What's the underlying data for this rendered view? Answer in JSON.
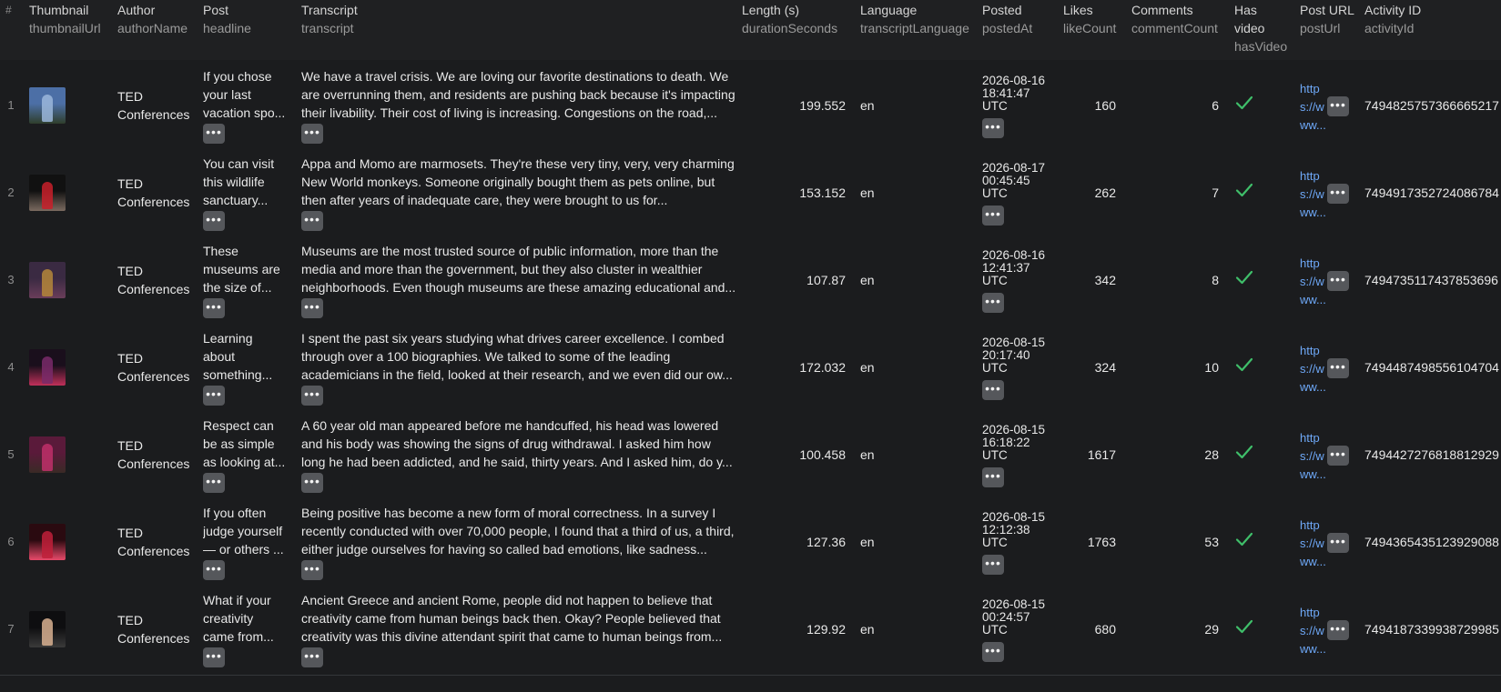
{
  "columns": [
    {
      "label": "#",
      "sub": ""
    },
    {
      "label": "Thumbnail",
      "sub": "thumbnailUrl"
    },
    {
      "label": "Author",
      "sub": "authorName"
    },
    {
      "label": "Post",
      "sub": "headline"
    },
    {
      "label": "Transcript",
      "sub": "transcript"
    },
    {
      "label": "Length (s)",
      "sub": "durationSeconds"
    },
    {
      "label": "Language",
      "sub": "transcriptLanguage"
    },
    {
      "label": "Posted",
      "sub": "postedAt"
    },
    {
      "label": "Likes",
      "sub": "likeCount"
    },
    {
      "label": "Comments",
      "sub": "commentCount"
    },
    {
      "label": "Has",
      "label2": "video",
      "sub": "hasVideo"
    },
    {
      "label": "Post URL",
      "sub": "postUrl"
    },
    {
      "label": "Activity ID",
      "sub": "activityId"
    }
  ],
  "more_glyph": "•••",
  "check_color": "#3fbf6a",
  "rows": [
    {
      "num": "1",
      "thumb_icon": "speaker-on-stage-thumbnail",
      "thumb_colors": [
        "#4c6fa6",
        "#9bb7db",
        "#2f3e2c"
      ],
      "author": "TED Conferences",
      "headline": "If you chose your last vacation spo...",
      "transcript": "We have a travel crisis. We are loving our favorite destinations to death. We are overrunning them, and residents are pushing back because it's impacting their livability. Their cost of living is increasing. Congestions on the road,...",
      "duration": "199.552",
      "lang": "en",
      "posted_date": "2026-08-16",
      "posted_time": "18:41:47",
      "posted_tz": "UTC",
      "likes": "160",
      "comments": "6",
      "url_text": "https://www...",
      "activity": "7494825757366665217"
    },
    {
      "num": "2",
      "thumb_icon": "ted-logo-audience-thumbnail",
      "thumb_colors": [
        "#111111",
        "#c8202a",
        "#7a6a60"
      ],
      "author": "TED Conferences",
      "headline": "You can visit this wildlife sanctuary...",
      "transcript": "Appa and Momo are marmosets. They're these very tiny, very, very charming New World monkeys. Someone originally bought them as pets online, but then after years of inadequate care, they were brought to us for...",
      "duration": "153.152",
      "lang": "en",
      "posted_date": "2026-08-17",
      "posted_time": "00:45:45",
      "posted_tz": "UTC",
      "likes": "262",
      "comments": "7",
      "url_text": "https://www...",
      "activity": "7494917352724086784"
    },
    {
      "num": "3",
      "thumb_icon": "speaker-portrait-thumbnail",
      "thumb_colors": [
        "#3a2a42",
        "#b5873a",
        "#6a3d5a"
      ],
      "author": "TED Conferences",
      "headline": "These museums are the size of...",
      "transcript": "Museums are the most trusted source of public information, more than the media and more than the government, but they also cluster in wealthier neighborhoods. Even though museums are these amazing educational and...",
      "duration": "107.87",
      "lang": "en",
      "posted_date": "2026-08-16",
      "posted_time": "12:41:37",
      "posted_tz": "UTC",
      "likes": "342",
      "comments": "8",
      "url_text": "https://www...",
      "activity": "7494735117437853696"
    },
    {
      "num": "4",
      "thumb_icon": "speaker-dark-stage-thumbnail",
      "thumb_colors": [
        "#1a0f1c",
        "#7a2a6a",
        "#c0305a"
      ],
      "author": "TED Conferences",
      "headline": "Learning about something...",
      "transcript": "I spent the past six years studying what drives career excellence. I combed through over a 100 biographies. We talked to some of the leading academicians in the field, looked at their research, and we even did our ow...",
      "duration": "172.032",
      "lang": "en",
      "posted_date": "2026-08-15",
      "posted_time": "20:17:40",
      "posted_tz": "UTC",
      "likes": "324",
      "comments": "10",
      "url_text": "https://www...",
      "activity": "7494487498556104704"
    },
    {
      "num": "5",
      "thumb_icon": "speaker-closeup-thumbnail",
      "thumb_colors": [
        "#5a1a3a",
        "#c0306a",
        "#3a2a26"
      ],
      "author": "TED Conferences",
      "headline": "Respect can be as simple as looking at...",
      "transcript": "A 60 year old man appeared before me handcuffed, his head was lowered and his body was showing the signs of drug withdrawal. I asked him how long he had been addicted, and he said, thirty years. And I asked him, do y...",
      "duration": "100.458",
      "lang": "en",
      "posted_date": "2026-08-15",
      "posted_time": "16:18:22",
      "posted_tz": "UTC",
      "likes": "1617",
      "comments": "28",
      "url_text": "https://www...",
      "activity": "7494427276818812929"
    },
    {
      "num": "6",
      "thumb_icon": "speaker-red-stage-thumbnail",
      "thumb_colors": [
        "#2a0a10",
        "#c0203a",
        "#e84a6a"
      ],
      "author": "TED Conferences",
      "headline": "If you often judge yourself — or others ...",
      "transcript": "Being positive has become a new form of moral correctness. In a survey I recently conducted with over 70,000 people, I found that a third of us, a third, either judge ourselves for having so called bad emotions, like sadness...",
      "duration": "127.36",
      "lang": "en",
      "posted_date": "2026-08-15",
      "posted_time": "12:12:38",
      "posted_tz": "UTC",
      "likes": "1763",
      "comments": "53",
      "url_text": "https://www...",
      "activity": "7494365435123929088"
    },
    {
      "num": "7",
      "thumb_icon": "speaker-spotlight-thumbnail",
      "thumb_colors": [
        "#0e0e10",
        "#d8b090",
        "#3a3a3a"
      ],
      "author": "TED Conferences",
      "headline": "What if your creativity came from...",
      "transcript": "Ancient Greece and ancient Rome, people did not happen to believe that creativity came from human beings back then. Okay? People believed that creativity was this divine attendant spirit that came to human beings from...",
      "duration": "129.92",
      "lang": "en",
      "posted_date": "2026-08-15",
      "posted_time": "00:24:57",
      "posted_tz": "UTC",
      "likes": "680",
      "comments": "29",
      "url_text": "https://www...",
      "activity": "7494187339938729985"
    }
  ]
}
